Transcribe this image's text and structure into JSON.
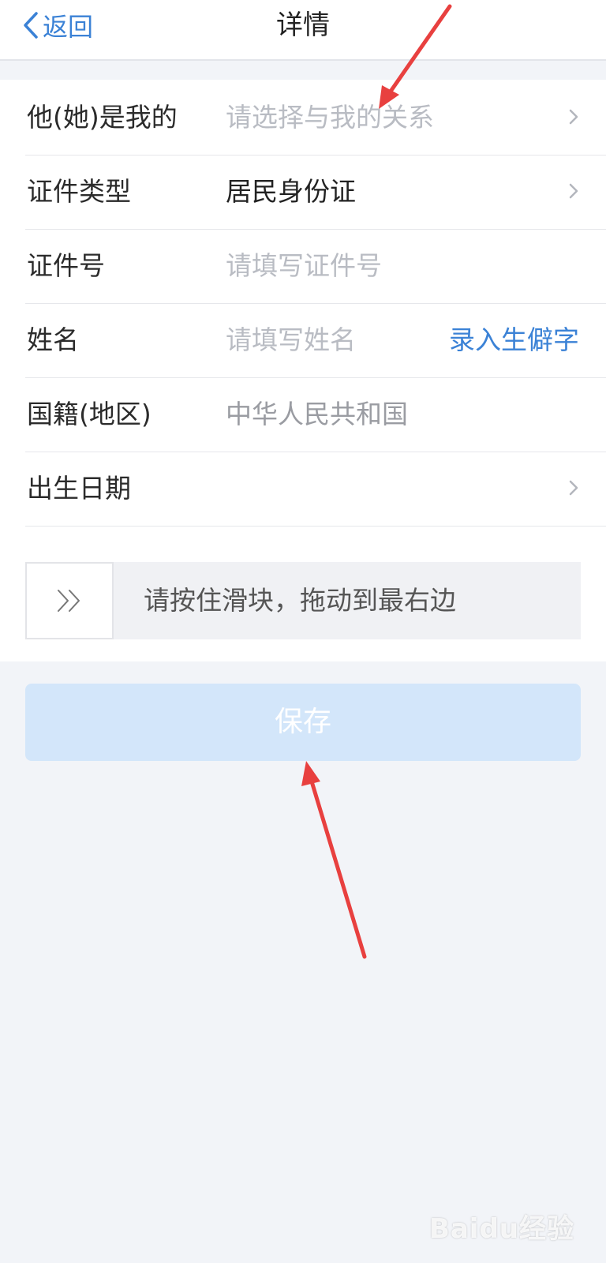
{
  "nav": {
    "back_label": "返回",
    "title": "详情"
  },
  "form": {
    "relation": {
      "label": "他(她)是我的",
      "placeholder": "请选择与我的关系",
      "icon": "chevron-right-icon"
    },
    "id_type": {
      "label": "证件类型",
      "value": "居民身份证",
      "icon": "chevron-right-icon"
    },
    "id_number": {
      "label": "证件号",
      "placeholder": "请填写证件号"
    },
    "name": {
      "label": "姓名",
      "placeholder": "请填写姓名",
      "rare_char_link": "录入生僻字"
    },
    "nationality": {
      "label": "国籍(地区)",
      "value": "中华人民共和国"
    },
    "birth_date": {
      "label": "出生日期",
      "value": "",
      "icon": "chevron-right-icon"
    }
  },
  "slider": {
    "text": "请按住滑块，拖动到最右边",
    "handle_icon": "double-chevron-right-icon"
  },
  "save_button": {
    "label": "保存"
  },
  "watermark": {
    "text": "Baidu经验"
  },
  "colors": {
    "accent": "#3b82d6",
    "save_disabled_bg": "#d3e6fa",
    "page_bg": "#f2f4f8",
    "annotation_arrow": "#e8403f"
  }
}
